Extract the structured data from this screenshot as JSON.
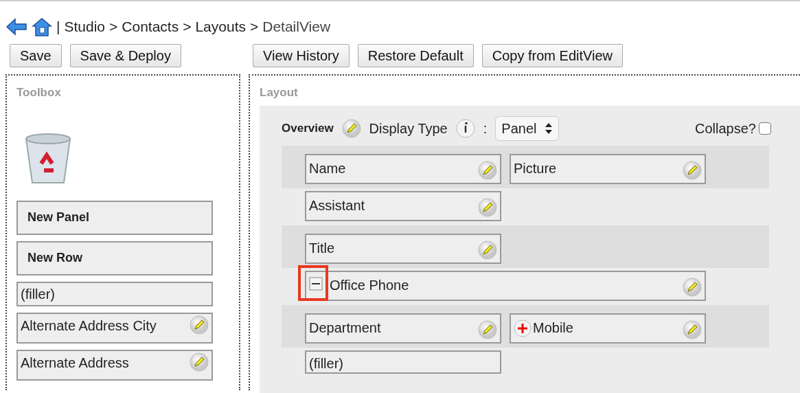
{
  "breadcrumb": {
    "links": [
      "Studio",
      "Contacts",
      "Layouts"
    ],
    "separator": "|",
    "arrow": ">",
    "current": "DetailView"
  },
  "left_buttons": [
    "Save",
    "Save & Deploy"
  ],
  "right_buttons": [
    "View History",
    "Restore Default",
    "Copy from EditView"
  ],
  "toolbox": {
    "title": "Toolbox",
    "items": [
      {
        "kind": "panel",
        "label": "New Panel"
      },
      {
        "kind": "row",
        "label": "New Row"
      },
      {
        "kind": "filler",
        "label": "(filler)"
      },
      {
        "kind": "field",
        "label": "Alternate Address City"
      },
      {
        "kind": "field",
        "label": "Alternate Address"
      }
    ]
  },
  "layout": {
    "title": "Layout",
    "panel": {
      "name": "Overview",
      "display_type_label": "Display Type",
      "colon": ":",
      "display_type": "Panel",
      "collapse_label": "Collapse?",
      "collapse_checked": false,
      "rows": [
        [
          {
            "kind": "field",
            "label": "Name",
            "wide": false,
            "minus_button": false,
            "plus_button": false,
            "highlighted": false
          },
          {
            "kind": "field",
            "label": "Picture",
            "wide": false,
            "minus_button": false,
            "plus_button": false,
            "highlighted": false
          }
        ],
        [
          {
            "kind": "field",
            "label": "Assistant",
            "wide": false,
            "minus_button": false,
            "plus_button": false,
            "highlighted": false
          }
        ],
        [
          {
            "kind": "field",
            "label": "Title",
            "wide": false,
            "minus_button": false,
            "plus_button": false,
            "highlighted": false
          }
        ],
        [
          {
            "kind": "field",
            "label": "Office Phone",
            "wide": true,
            "minus_button": true,
            "plus_button": false,
            "highlighted": true
          }
        ],
        [
          {
            "kind": "field",
            "label": "Department",
            "wide": false,
            "minus_button": false,
            "plus_button": false,
            "highlighted": false
          },
          {
            "kind": "field",
            "label": "Mobile",
            "wide": false,
            "minus_button": false,
            "plus_button": true,
            "highlighted": false
          }
        ],
        [
          {
            "kind": "filler",
            "label": "(filler)",
            "wide": false,
            "minus_button": false,
            "plus_button": false,
            "highlighted": false
          }
        ]
      ]
    }
  }
}
